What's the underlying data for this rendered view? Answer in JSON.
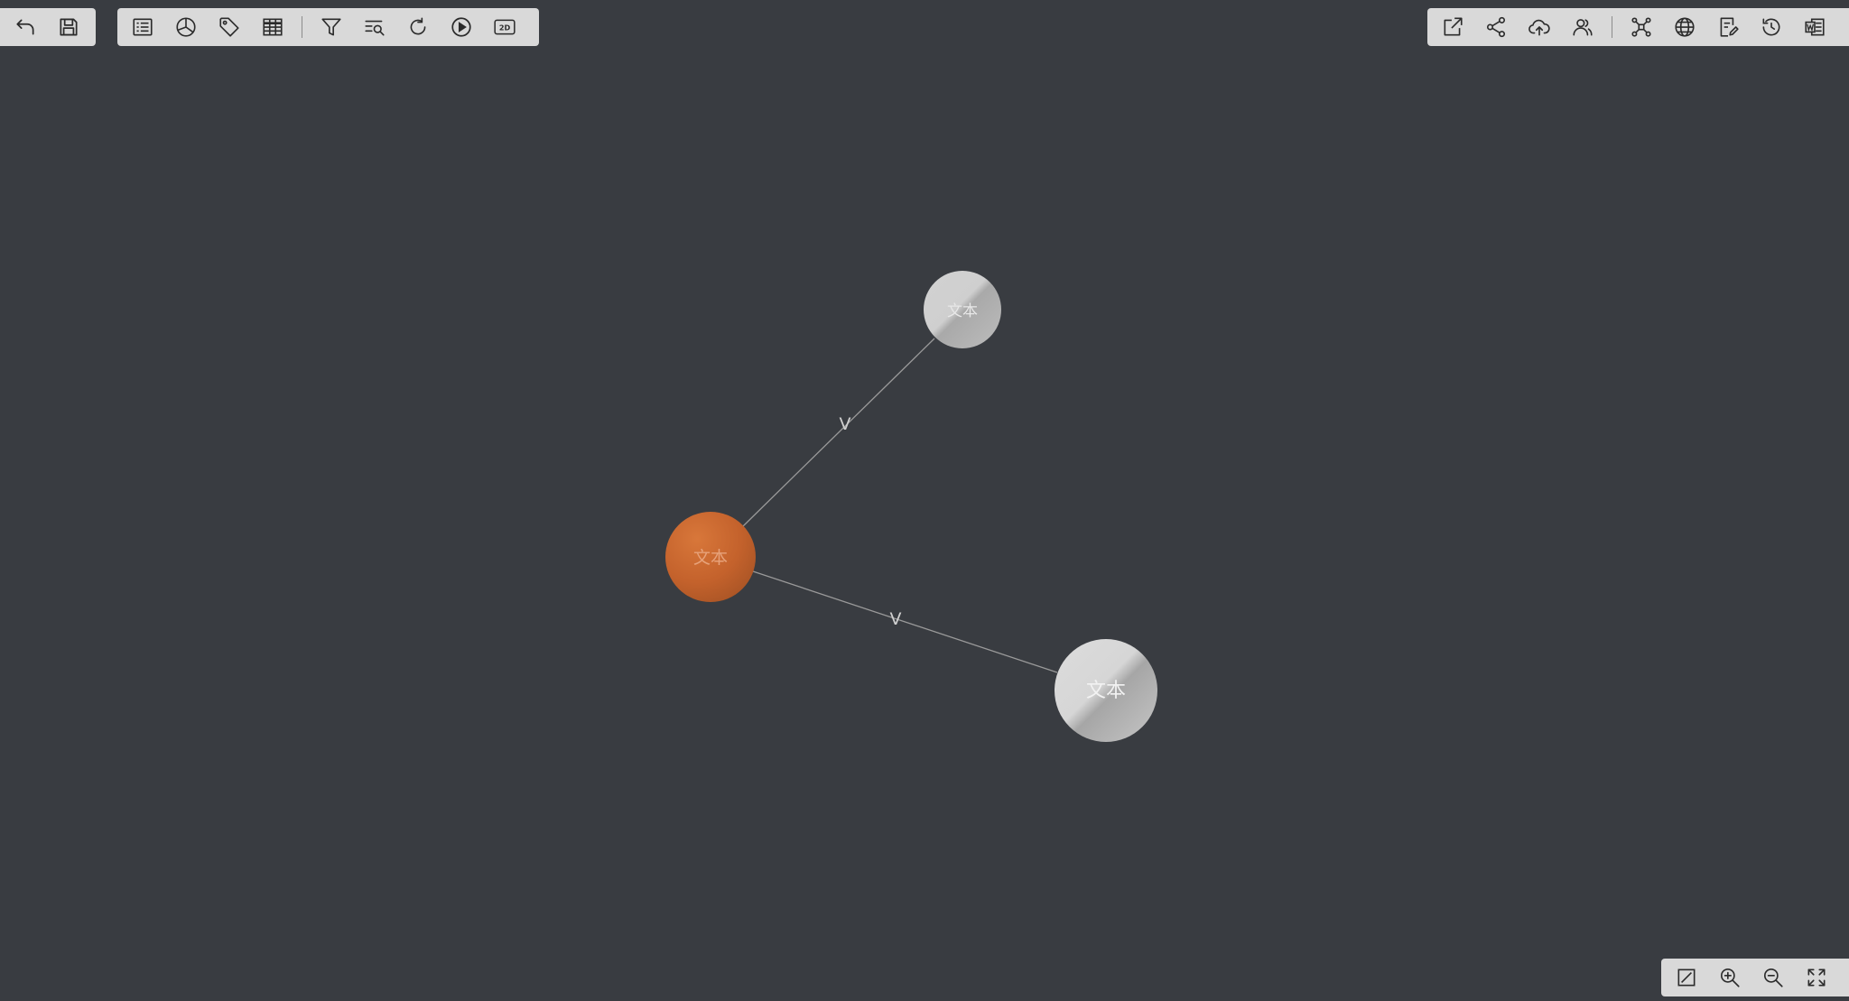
{
  "toolbar_left": {
    "buttons": [
      {
        "name": "undo-button",
        "icon": "undo-icon"
      },
      {
        "name": "save-button",
        "icon": "save-icon"
      }
    ]
  },
  "toolbar_main": {
    "buttons": [
      {
        "name": "list-button",
        "icon": "list-icon"
      },
      {
        "name": "statistics-button",
        "icon": "pie-chart-icon"
      },
      {
        "name": "tag-button",
        "icon": "tag-icon"
      },
      {
        "name": "table-button",
        "icon": "table-icon"
      },
      {
        "name": "filter-button",
        "icon": "filter-icon"
      },
      {
        "name": "search-list-button",
        "icon": "search-list-icon"
      },
      {
        "name": "refresh-button",
        "icon": "refresh-icon"
      },
      {
        "name": "play-button",
        "icon": "play-icon"
      },
      {
        "name": "view-2d-button",
        "icon": "2d-icon",
        "label": "2D"
      }
    ]
  },
  "toolbar_right": {
    "buttons": [
      {
        "name": "export-button",
        "icon": "external-link-icon"
      },
      {
        "name": "share-button",
        "icon": "share-icon"
      },
      {
        "name": "upload-button",
        "icon": "cloud-upload-icon"
      },
      {
        "name": "users-button",
        "icon": "users-icon"
      },
      {
        "name": "network-button",
        "icon": "network-icon"
      },
      {
        "name": "globe-button",
        "icon": "globe-icon"
      },
      {
        "name": "edit-doc-button",
        "icon": "edit-doc-icon"
      },
      {
        "name": "history-button",
        "icon": "history-icon"
      },
      {
        "name": "word-export-button",
        "icon": "word-doc-icon"
      }
    ]
  },
  "toolbar_zoom": {
    "buttons": [
      {
        "name": "fit-button",
        "icon": "fit-icon"
      },
      {
        "name": "zoom-in-button",
        "icon": "zoom-in-icon"
      },
      {
        "name": "zoom-out-button",
        "icon": "zoom-out-icon"
      },
      {
        "name": "fullscreen-button",
        "icon": "fullscreen-icon"
      }
    ]
  },
  "graph": {
    "nodes": [
      {
        "id": "n-top",
        "label": "文本",
        "style": "gray"
      },
      {
        "id": "n-center",
        "label": "文本",
        "style": "orange"
      },
      {
        "id": "n-bottom",
        "label": "文本",
        "style": "gray"
      }
    ],
    "edges": [
      {
        "from": "n-center",
        "to": "n-top",
        "label": "V"
      },
      {
        "from": "n-center",
        "to": "n-bottom",
        "label": "V"
      }
    ],
    "colors": {
      "background": "#393c41",
      "edge": "#9a9a9a",
      "orange": "#c8642d",
      "gray": "#c4c4c4"
    }
  }
}
